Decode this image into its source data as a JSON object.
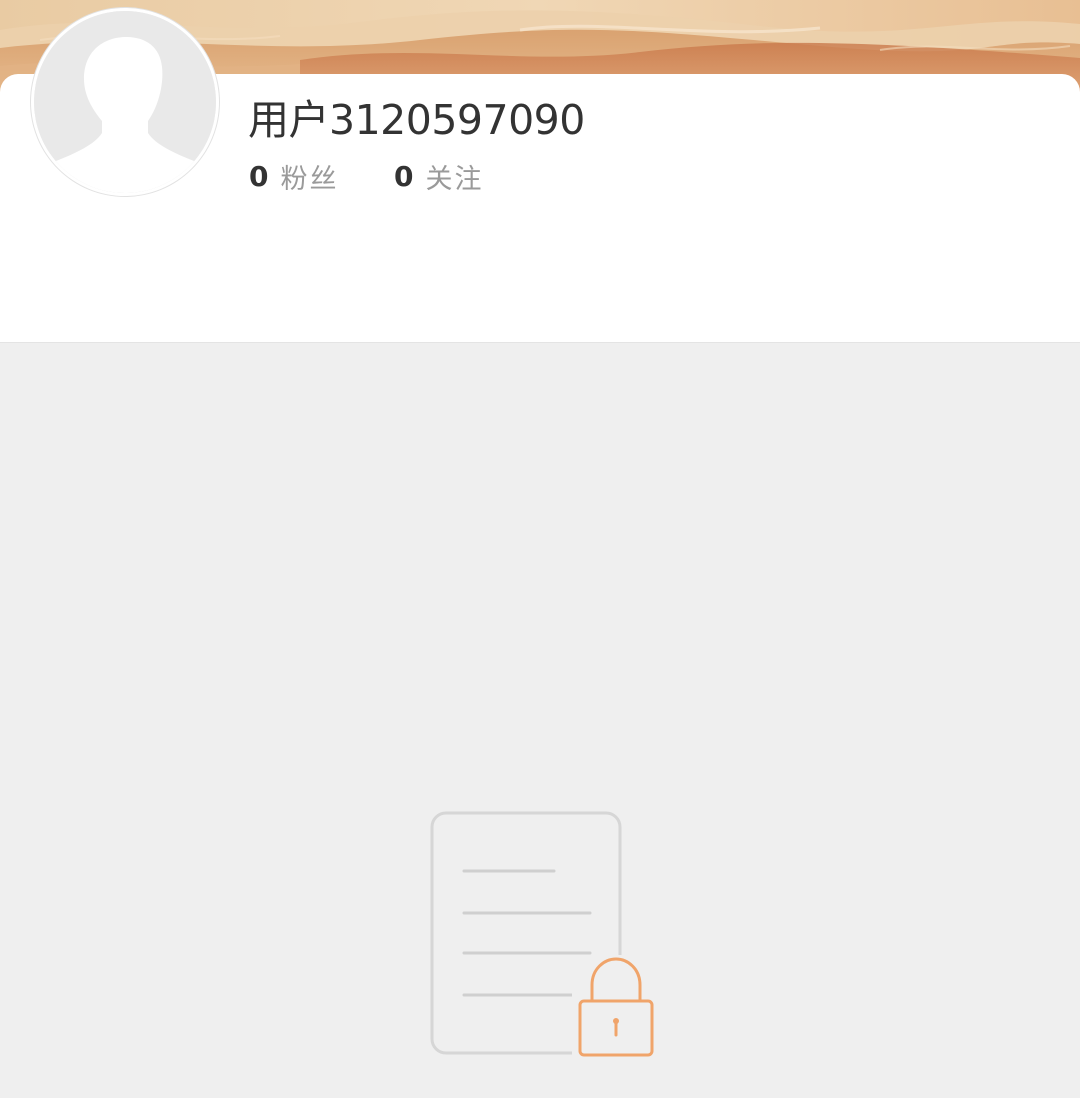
{
  "profile": {
    "username": "用户3120597090",
    "followers": {
      "count": "0",
      "label": "粉丝"
    },
    "following": {
      "count": "0",
      "label": "关注"
    }
  },
  "icons": {
    "avatar": "default-avatar-icon",
    "empty_state": "locked-document-icon"
  },
  "colors": {
    "background": "#efefef",
    "card": "#ffffff",
    "text_primary": "#333333",
    "text_secondary": "#9a9a9a",
    "lock_accent": "#f0a46a",
    "document_stroke": "#d6d6d6"
  }
}
